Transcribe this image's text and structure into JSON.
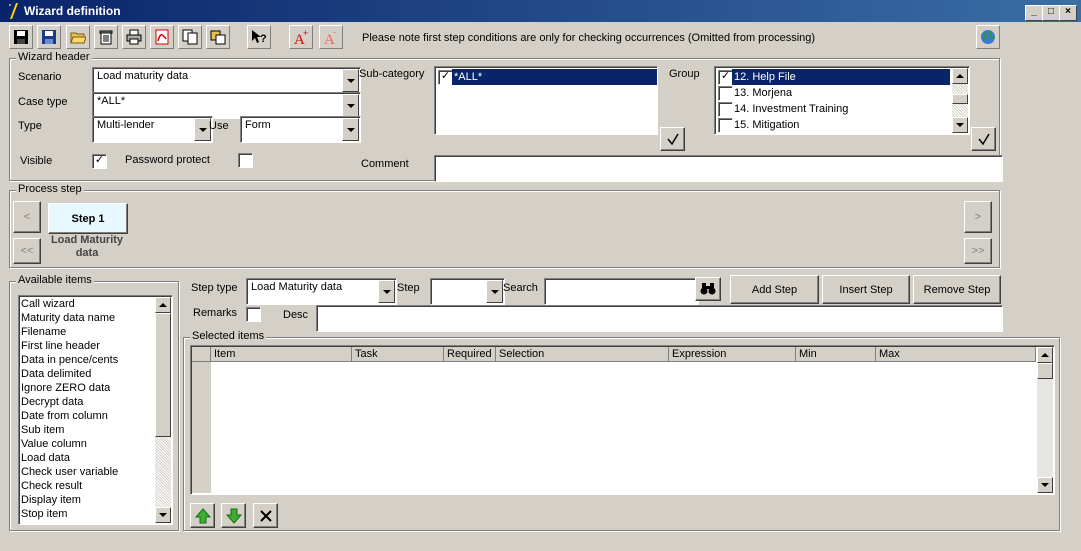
{
  "window": {
    "title": "Wizard definition",
    "controls": [
      "_",
      "□",
      "×"
    ]
  },
  "toolbar": {
    "icons": [
      "save-icon",
      "save-as-icon",
      "open-folder-icon",
      "delete-icon",
      "print-icon",
      "pdf-icon",
      "copy-icon",
      "paste-icon",
      "help-icon",
      "text-increase-icon",
      "text-decrease-icon"
    ],
    "note": "Please note first step conditions are only for checking occurrences (Omitted from processing)"
  },
  "wizard_header": {
    "legend": "Wizard header",
    "scenario_label": "Scenario",
    "scenario_value": "Load maturity data",
    "case_type_label": "Case type",
    "case_type_value": "*ALL*",
    "type_label": "Type",
    "type_value": "Multi-lender",
    "use_label": "Use",
    "use_value": "Form",
    "visible_label": "Visible",
    "visible_checked": "✓",
    "password_label": "Password protect",
    "password_checked": "",
    "subcategory_label": "Sub-category",
    "subcategory_items": [
      {
        "label": "*ALL*",
        "check": "✓"
      }
    ],
    "group_label": "Group",
    "group_items": [
      {
        "label": "12. Help File",
        "check": "✓"
      },
      {
        "label": "13. Morjena",
        "check": ""
      },
      {
        "label": "14. Investment Training",
        "check": ""
      },
      {
        "label": "15. Mitigation",
        "check": ""
      }
    ],
    "comment_label": "Comment",
    "comment_value": ""
  },
  "process_step": {
    "legend": "Process step",
    "prev": "<",
    "first": "<<",
    "next": ">",
    "last": ">>",
    "step_button": "Step 1",
    "step_caption": "Load Maturity data"
  },
  "available_items": {
    "legend": "Available items",
    "items": [
      "Call wizard",
      "Maturity data name",
      "Filename",
      "First line header",
      "Data in pence/cents",
      "Data delimited",
      "Ignore ZERO data",
      "Decrypt data",
      "Date from column",
      "Sub item",
      "Value column",
      "Load data",
      "Check user variable",
      "Check result",
      "Display item",
      "Stop item"
    ]
  },
  "step_controls": {
    "step_type_label": "Step type",
    "step_type_value": "Load Maturity data",
    "step_label": "Step",
    "step_value": "",
    "search_label": "Search",
    "search_value": "",
    "add_step": "Add Step",
    "insert_step": "Insert Step",
    "remove_step": "Remove Step",
    "remarks_label": "Remarks",
    "desc_label": "Desc",
    "desc_value": ""
  },
  "selected_items": {
    "legend": "Selected items",
    "columns": [
      "Item",
      "Task",
      "Required",
      "Selection",
      "Expression",
      "Min",
      "Max"
    ]
  },
  "colors": {
    "title_bar": "#0a246a",
    "selection": "#0a246a",
    "face": "#d4d0c8"
  }
}
